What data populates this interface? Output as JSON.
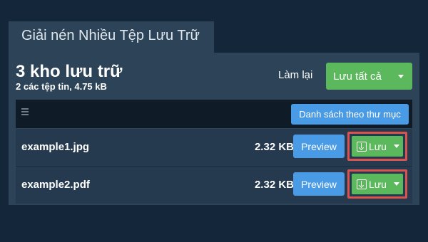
{
  "dialog": {
    "title": "Giải nén Nhiều Tệp Lưu Trữ"
  },
  "summary": {
    "heading": "3 kho lưu trữ",
    "details": "2 các tệp tin, 4.75 kB"
  },
  "actions": {
    "reset_label": "Làm lại",
    "save_all_label": "Lưu tất cả"
  },
  "table": {
    "directory_button": "Danh sách theo thư mục",
    "files": [
      {
        "name": "example1.jpg",
        "size": "2.32 KB",
        "preview_label": "Preview",
        "save_label": "Lưu"
      },
      {
        "name": "example2.pdf",
        "size": "2.32 KB",
        "preview_label": "Preview",
        "save_label": "Lưu"
      }
    ]
  },
  "colors": {
    "background": "#14263a",
    "panel": "#2d4358",
    "header": "#0f1b26",
    "row": "#253a4f",
    "success": "#5cb85c",
    "primary": "#4a9be6",
    "highlight": "#d9534f"
  },
  "icons": [
    "list-icon",
    "download-icon",
    "caret-down-icon"
  ]
}
